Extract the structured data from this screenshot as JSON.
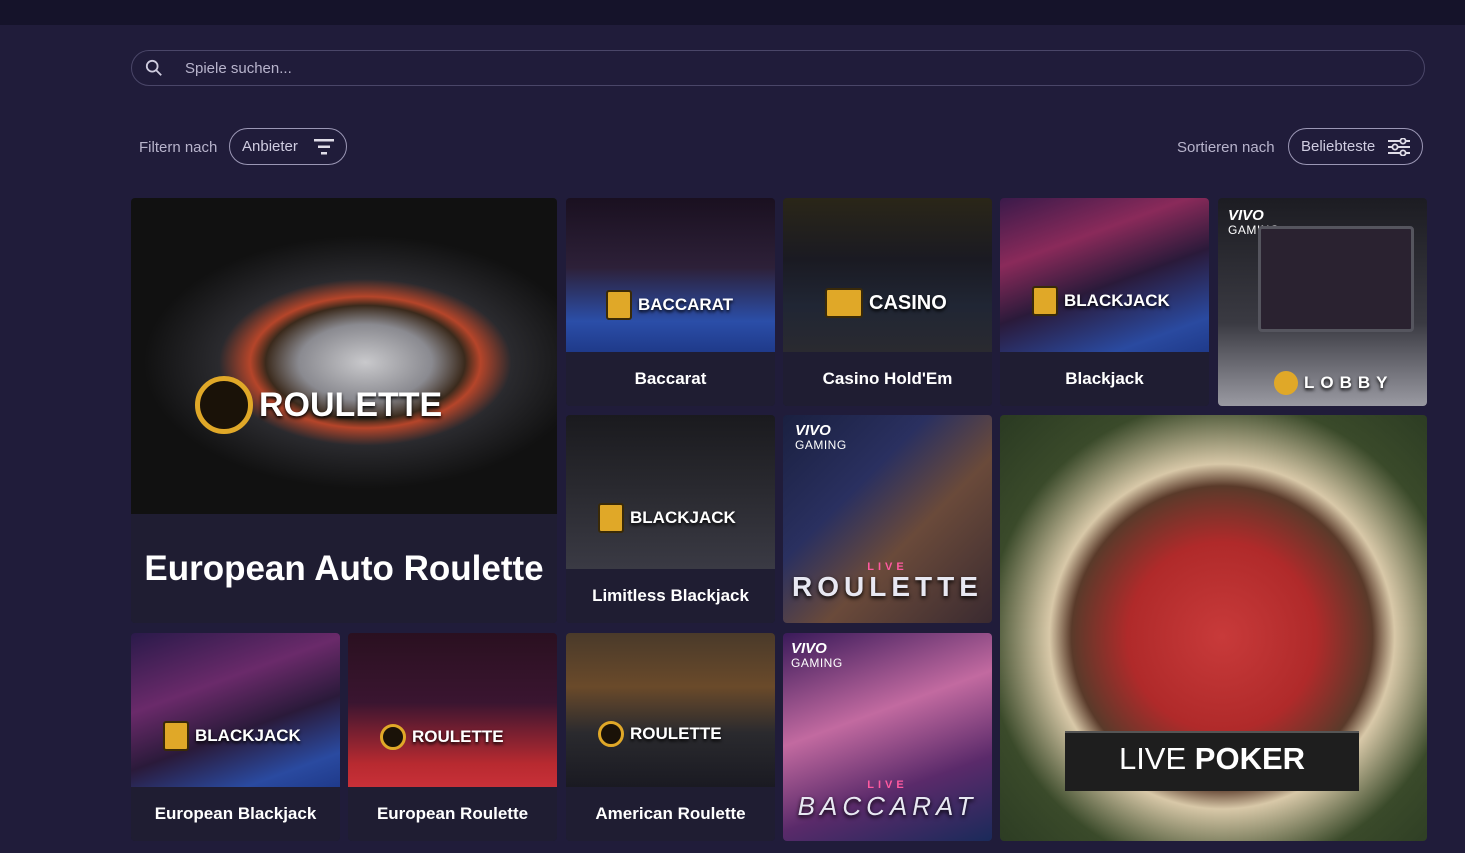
{
  "search": {
    "placeholder": "Spiele suchen..."
  },
  "filter": {
    "label": "Filtern nach",
    "button": "Anbieter"
  },
  "sort": {
    "label": "Sortieren nach",
    "button": "Beliebteste"
  },
  "games": {
    "european_auto_roulette": {
      "badge": "ROULETTE",
      "title": "European Auto Roulette"
    },
    "baccarat": {
      "badge": "BACCARAT",
      "title": "Baccarat"
    },
    "casino_holdem": {
      "badge": "CASINO",
      "title": "Casino Hold'Em"
    },
    "blackjack": {
      "badge": "BLACKJACK",
      "title": "Blackjack"
    },
    "lobby": {
      "brand": "VIVO",
      "brand_sub": "GAMING",
      "badge": "LOBBY"
    },
    "limitless_blackjack": {
      "badge": "BLACKJACK",
      "title": "Limitless Blackjack"
    },
    "live_roulette": {
      "brand": "VIVO",
      "brand_sub": "GAMING",
      "live": "LIVE",
      "badge": "ROULETTE"
    },
    "live_poker": {
      "badge_light": "LIVE",
      "badge_bold": "POKER"
    },
    "european_blackjack": {
      "badge": "BLACKJACK",
      "title": "European Blackjack"
    },
    "european_roulette": {
      "badge": "ROULETTE",
      "title": "European Roulette"
    },
    "american_roulette": {
      "badge": "ROULETTE",
      "title": "American Roulette"
    },
    "live_baccarat": {
      "brand": "VIVO",
      "brand_sub": "GAMING",
      "live": "LIVE",
      "badge": "BACCARAT"
    }
  },
  "colors": {
    "background": "#201c3a",
    "topbar": "#15132a",
    "accent_gold": "#e0a828",
    "caption_bg": "#1f1d32"
  }
}
